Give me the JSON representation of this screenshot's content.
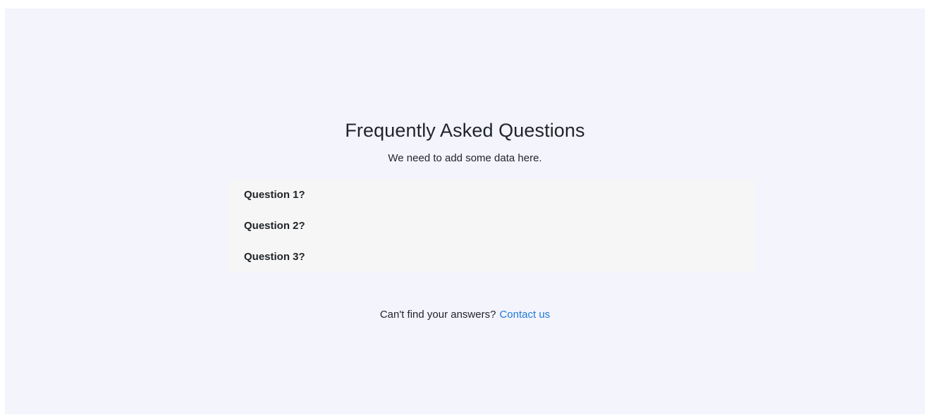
{
  "faq": {
    "title": "Frequently Asked Questions",
    "subtitle": "We need to add some data here.",
    "questions": [
      {
        "label": "Question 1?"
      },
      {
        "label": "Question 2?"
      },
      {
        "label": "Question 3?"
      }
    ]
  },
  "footer": {
    "prompt": "Can't find your answers?",
    "contact_label": "Contact us"
  },
  "colors": {
    "page_background": "#f4f4fd",
    "list_background": "#f6f6f6",
    "link": "#1e7ad6",
    "text": "#212529"
  }
}
